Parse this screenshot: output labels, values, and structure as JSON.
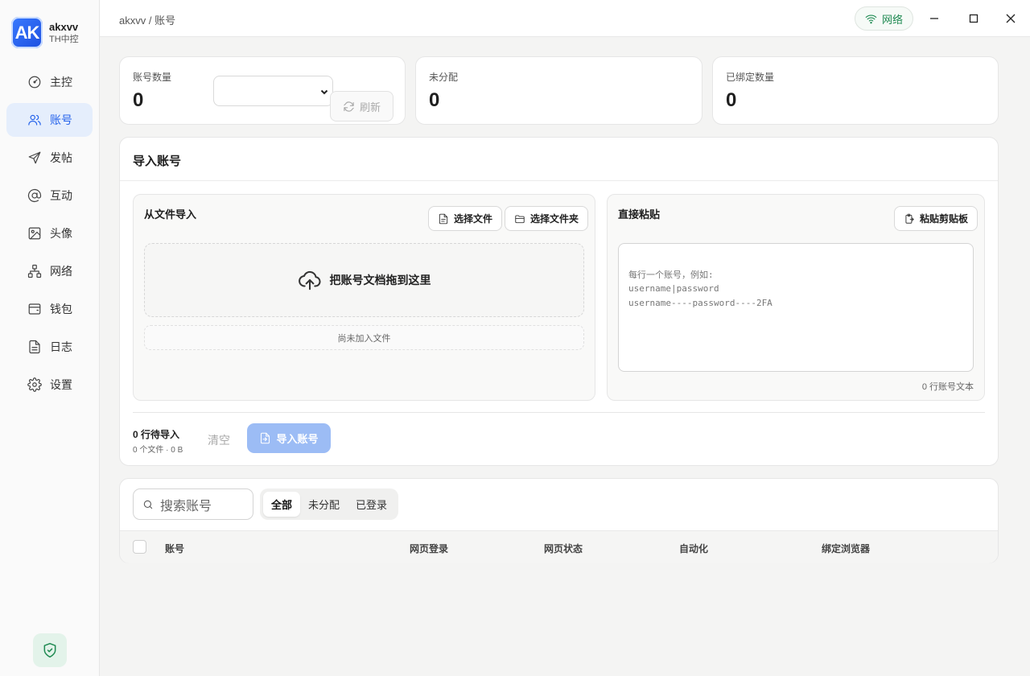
{
  "brand": {
    "logo_text": "AK",
    "name": "akxvv",
    "subtitle": "TH中控"
  },
  "sidebar": {
    "items": [
      {
        "label": "主控",
        "icon": "gauge-icon"
      },
      {
        "label": "账号",
        "icon": "users-icon",
        "active": true
      },
      {
        "label": "发帖",
        "icon": "send-icon"
      },
      {
        "label": "互动",
        "icon": "at-sign-icon"
      },
      {
        "label": "头像",
        "icon": "image-icon"
      },
      {
        "label": "网络",
        "icon": "network-icon"
      },
      {
        "label": "钱包",
        "icon": "wallet-icon"
      },
      {
        "label": "日志",
        "icon": "file-text-icon"
      },
      {
        "label": "设置",
        "icon": "gear-icon"
      }
    ],
    "footer_icon": "shield-check-icon"
  },
  "topbar": {
    "breadcrumb": "akxvv / 账号",
    "network_label": "网络",
    "network_icon": "wifi-icon",
    "window_controls": [
      "minimize-icon",
      "maximize-icon",
      "close-icon"
    ]
  },
  "stats": {
    "account_count": {
      "label": "账号数量",
      "value": "0",
      "select_value": ""
    },
    "refresh_label": "刷新",
    "unassigned": {
      "label": "未分配",
      "value": "0"
    },
    "bound": {
      "label": "已绑定数量",
      "value": "0"
    }
  },
  "import": {
    "title": "导入账号",
    "file_panel": {
      "title": "从文件导入",
      "select_file": "选择文件",
      "select_folder": "选择文件夹",
      "drop_text": "把账号文档拖到这里",
      "empty_files": "尚未加入文件"
    },
    "paste_panel": {
      "title": "直接粘贴",
      "paste_button": "粘贴剪贴板",
      "placeholder": "每行一个账号，例如:\nusername|password\nusername----password----2FA",
      "line_count": "0 行账号文本"
    },
    "pending_main": "0 行待导入",
    "pending_sub": "0 个文件 · 0 B",
    "clear_label": "清空",
    "import_label": "导入账号"
  },
  "table": {
    "search_placeholder": "搜索账号",
    "filters": [
      "全部",
      "未分配",
      "已登录"
    ],
    "active_filter": "全部",
    "columns": [
      "账号",
      "网页登录",
      "网页状态",
      "自动化",
      "绑定浏览器"
    ]
  },
  "colors": {
    "accent": "#2563eb",
    "success": "#1f8a52",
    "disabled_primary": "#9cbcf5"
  }
}
